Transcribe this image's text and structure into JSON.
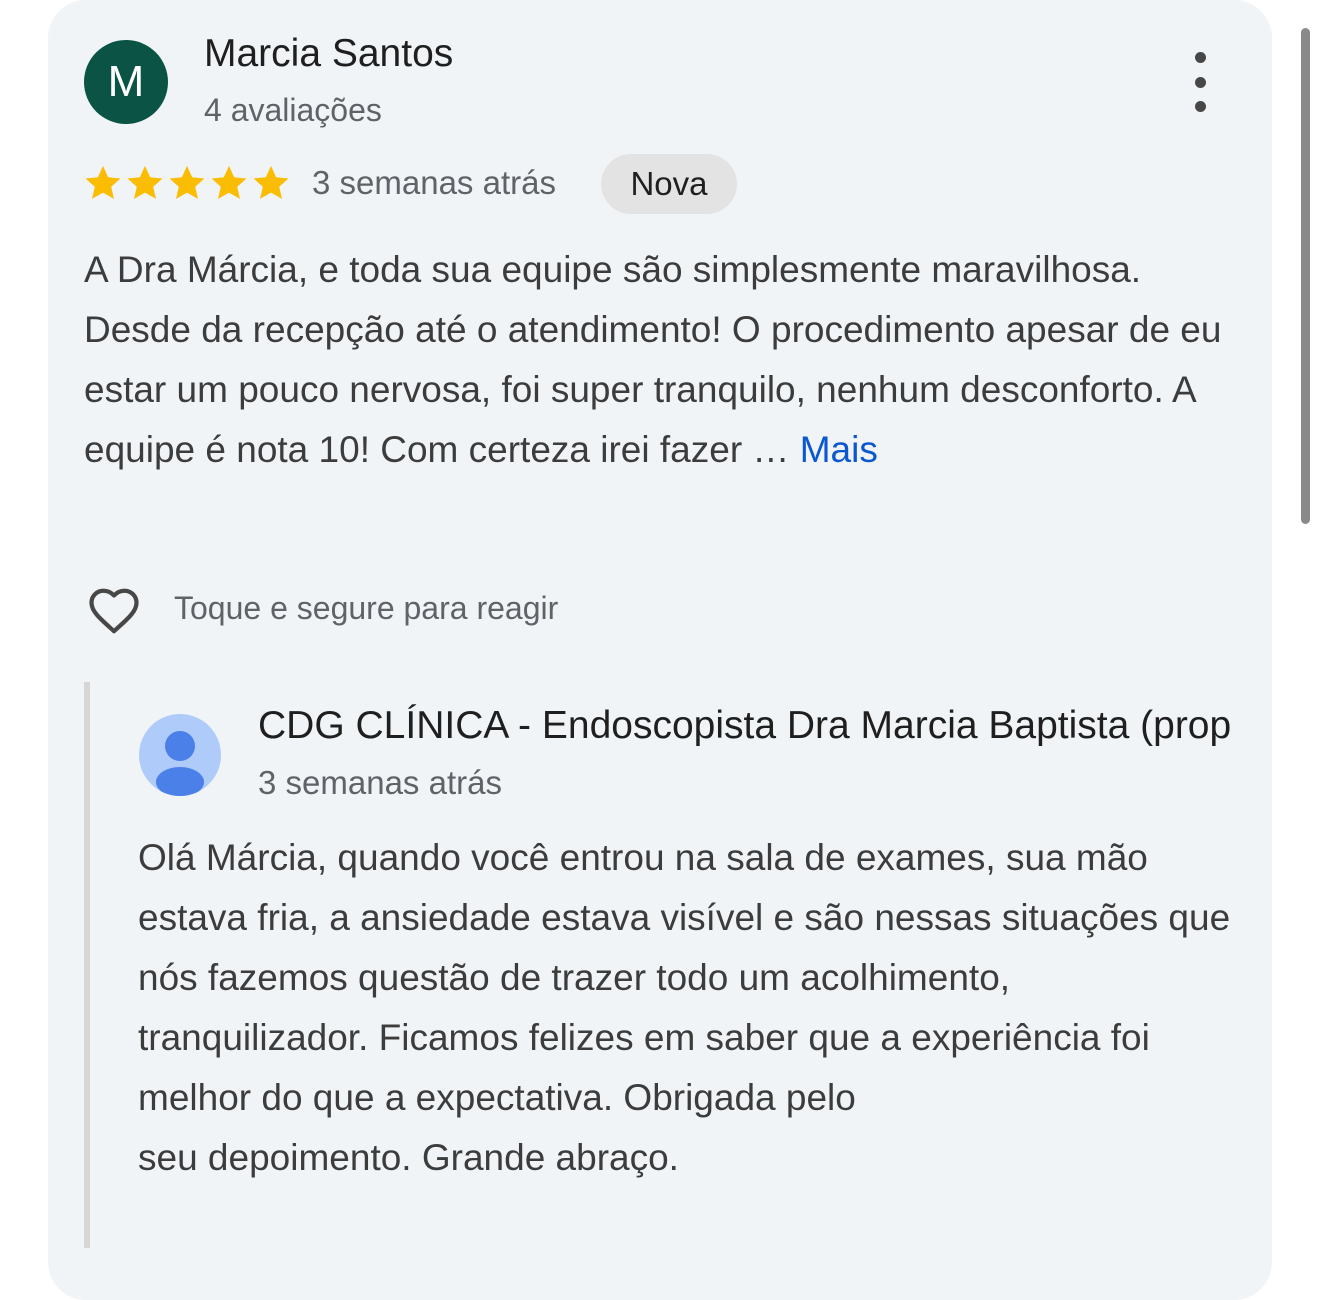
{
  "review": {
    "avatar_initial": "M",
    "avatar_color": "#0b5345",
    "reviewer_name": "Marcia Santos",
    "review_count": "4 avaliações",
    "rating": 5,
    "rating_max": 5,
    "star_color": "#fbbc04",
    "time_ago": "3 semanas atrás",
    "badge": "Nova",
    "text": "A Dra Márcia, e toda sua equipe são simplesmente maravilhosa. Desde da recepção até o atendimento! O procedimento apesar de eu estar um pouco nervosa, foi super tranquilo, nenhum desconforto. A equipe é nota 10! Com certeza irei fazer … ",
    "more_label": "Mais",
    "react_hint": "Toque e segure para reagir"
  },
  "reply": {
    "owner_name": "CDG CLÍNICA - Endoscopista Dra Marcia Baptista (prop",
    "time_ago": "3 semanas atrás",
    "text_main": "Olá Márcia, quando você entrou na sala de exames, sua mão estava fria, a ansiedade estava visível e são nessas situações que nós fazemos questão de trazer todo um acolhimento, tranquilizador. Ficamos felizes em saber que a experiência foi melhor do que a expectativa. Obrigada pelo",
    "text_end": "seu depoimento. Grande abraço."
  },
  "icons": {
    "menu": "more-vert-icon",
    "heart": "heart-outline-icon",
    "owner_avatar": "person-avatar-icon"
  }
}
